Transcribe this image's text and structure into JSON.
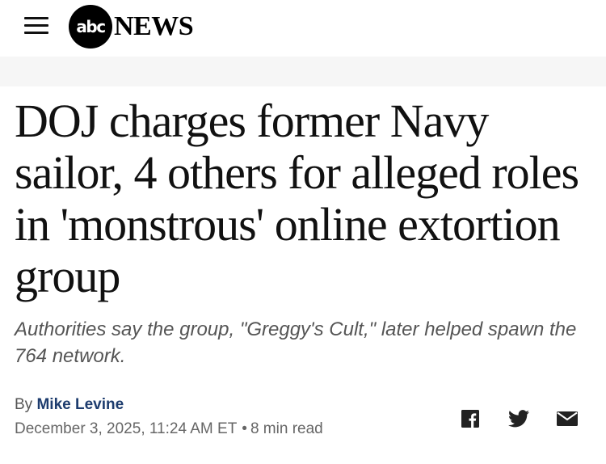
{
  "header": {
    "menu_icon": "hamburger-menu-icon",
    "logo_mark": "abc",
    "logo_word": "NEWS"
  },
  "article": {
    "headline": "DOJ charges former Navy sailor, 4 others for alleged roles in 'monstrous' online extortion group",
    "subhead": "Authorities say the group, \"Greggy's Cult,\" later helped spawn the 764 network.",
    "by_prefix": "By",
    "author": "Mike Levine",
    "date": "December 3, 2025, 11:24 AM ET",
    "separator": "•",
    "read_time": "8 min read"
  },
  "share": {
    "icons": [
      "facebook-icon",
      "twitter-icon",
      "email-icon"
    ]
  },
  "colors": {
    "author_link": "#1d3c6e",
    "subhead_text": "#555555",
    "header_bg": "#ffffff"
  }
}
